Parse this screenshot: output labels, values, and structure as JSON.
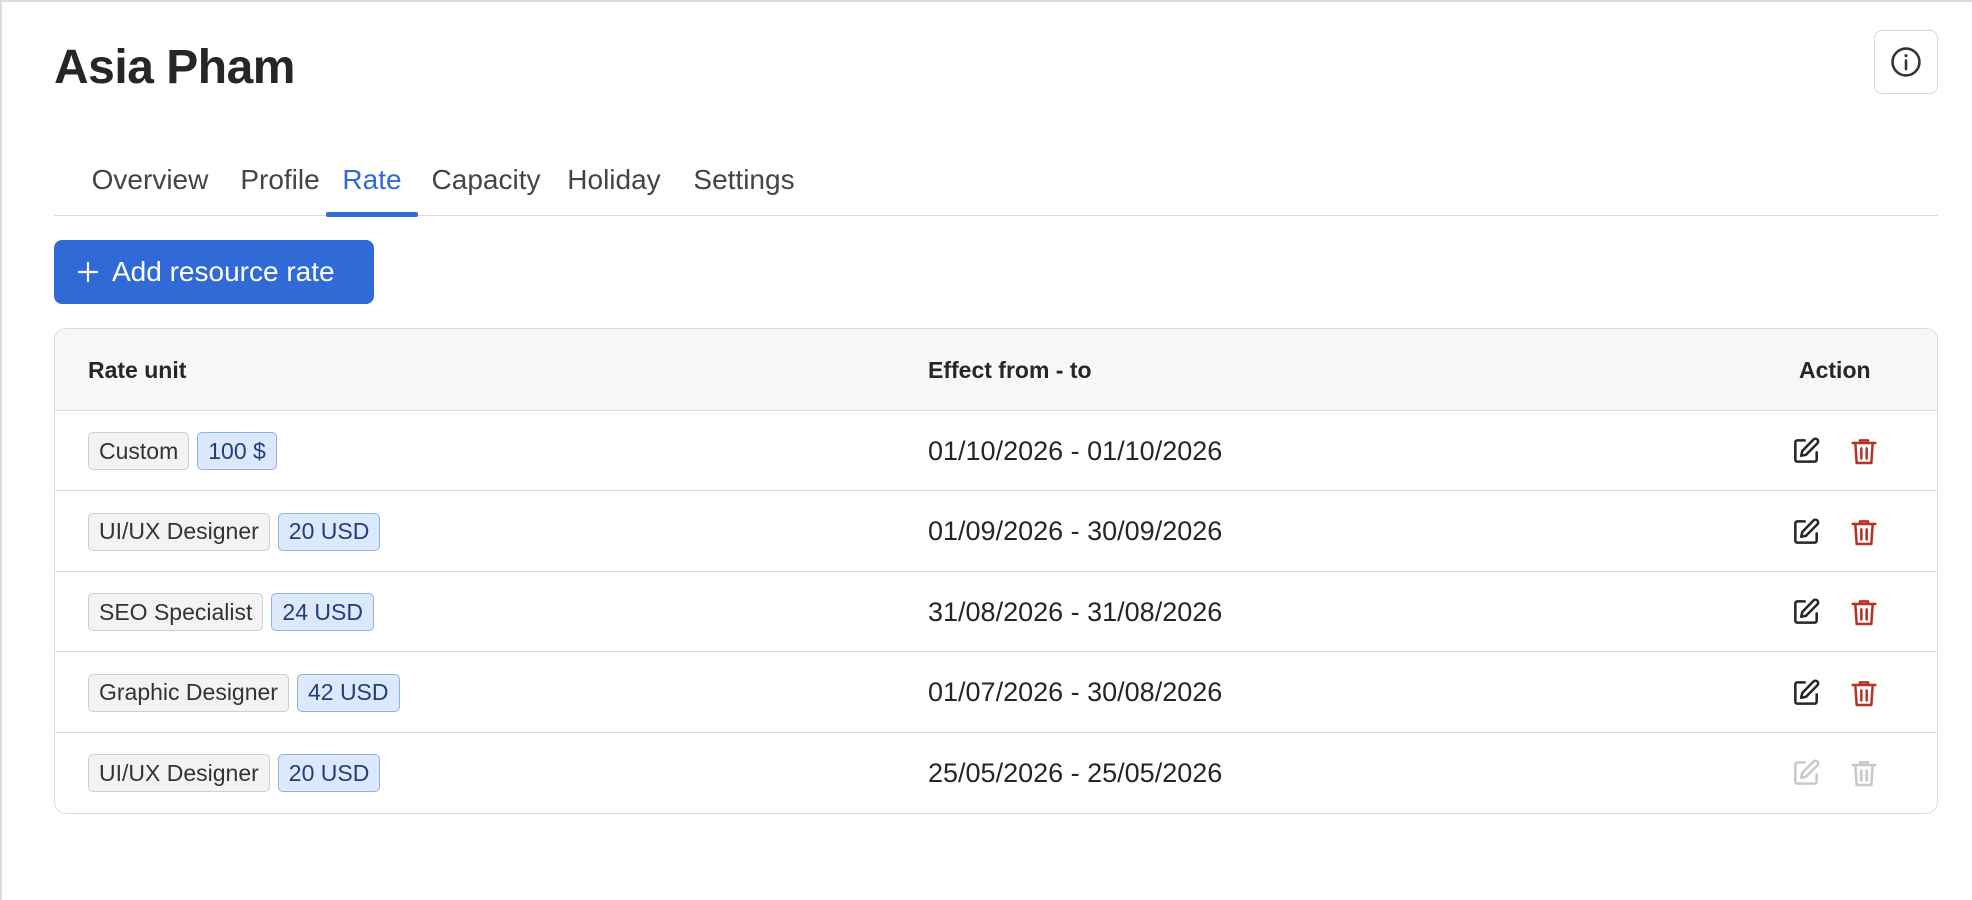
{
  "header": {
    "title": "Asia Pham",
    "info_icon": "info-circle-icon"
  },
  "tabs": [
    {
      "label": "Overview",
      "active": false
    },
    {
      "label": "Profile",
      "active": false
    },
    {
      "label": "Rate",
      "active": true
    },
    {
      "label": "Capacity",
      "active": false
    },
    {
      "label": "Holiday",
      "active": false
    },
    {
      "label": "Settings",
      "active": false
    }
  ],
  "toolbar": {
    "add_label": "Add resource rate",
    "add_icon": "plus-icon"
  },
  "table": {
    "columns": {
      "rate_unit": "Rate unit",
      "effect": "Effect from - to",
      "action": "Action"
    },
    "rows": [
      {
        "role": "Custom",
        "rate": "100 $",
        "effect": "01/10/2026 - 01/10/2026",
        "actions_enabled": true
      },
      {
        "role": "UI/UX Designer",
        "rate": "20 USD",
        "effect": "01/09/2026 - 30/09/2026",
        "actions_enabled": true
      },
      {
        "role": "SEO Specialist",
        "rate": "24 USD",
        "effect": "31/08/2026 - 31/08/2026",
        "actions_enabled": true
      },
      {
        "role": "Graphic Designer",
        "rate": "42 USD",
        "effect": "01/07/2026 - 30/08/2026",
        "actions_enabled": true
      },
      {
        "role": "UI/UX Designer",
        "rate": "20 USD",
        "effect": "25/05/2026 - 25/05/2026",
        "actions_enabled": false
      }
    ]
  },
  "colors": {
    "accent": "#2f6ad6",
    "danger": "#b3342b",
    "disabled": "#c9c9c9",
    "tag_blue_bg": "#dce8fc"
  }
}
